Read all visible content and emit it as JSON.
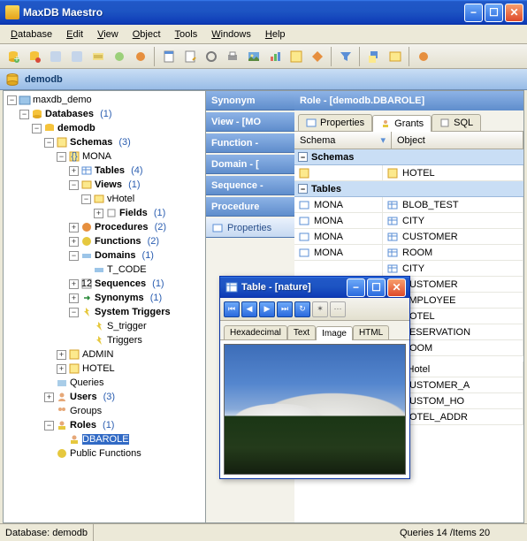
{
  "window": {
    "title": "MaxDB Maestro"
  },
  "menu": [
    "Database",
    "Edit",
    "View",
    "Object",
    "Tools",
    "Windows",
    "Help"
  ],
  "dbbar": {
    "name": "demodb"
  },
  "tree": {
    "root": "maxdb_demo",
    "databases": {
      "label": "Databases",
      "count": "(1)"
    },
    "demodb": "demodb",
    "schemas": {
      "label": "Schemas",
      "count": "(3)"
    },
    "mona": "MONA",
    "tables": {
      "label": "Tables",
      "count": "(4)"
    },
    "views": {
      "label": "Views",
      "count": "(1)"
    },
    "vhotel": "vHotel",
    "fields": {
      "label": "Fields",
      "count": "(1)"
    },
    "procedures": {
      "label": "Procedures",
      "count": "(2)"
    },
    "functions": {
      "label": "Functions",
      "count": "(2)"
    },
    "domains": {
      "label": "Domains",
      "count": "(1)"
    },
    "tcode": "T_CODE",
    "sequences": {
      "label": "Sequences",
      "count": "(1)"
    },
    "synonyms": {
      "label": "Synonyms",
      "count": "(1)"
    },
    "systriggers": "System Triggers",
    "strigger": "S_trigger",
    "triggers": "Triggers",
    "admin": "ADMIN",
    "hotel": "HOTEL",
    "queries": "Queries",
    "users": {
      "label": "Users",
      "count": "(3)"
    },
    "groups": "Groups",
    "roles": {
      "label": "Roles",
      "count": "(1)"
    },
    "dbarole": "DBAROLE",
    "pubfunc": "Public Functions"
  },
  "stacktabs": [
    "Synonym",
    "View - [MO",
    "Function -",
    "Domain - [",
    "Sequence -",
    "Procedure"
  ],
  "propTab": "Properties",
  "role": {
    "title": "Role - [demodb.DBAROLE]",
    "tabs": [
      "Properties",
      "Grants",
      "SQL"
    ],
    "col_schema": "Schema",
    "col_object": "Object",
    "sections": {
      "schemas": "Schemas",
      "tables": "Tables"
    },
    "rows": [
      {
        "schema": "",
        "object": "HOTEL"
      },
      {
        "schema": "MONA",
        "object": "BLOB_TEST"
      },
      {
        "schema": "MONA",
        "object": "CITY"
      },
      {
        "schema": "MONA",
        "object": "CUSTOMER"
      },
      {
        "schema": "MONA",
        "object": "ROOM"
      },
      {
        "schema": "",
        "object": "CITY"
      },
      {
        "schema": "",
        "object": "CUSTOMER"
      },
      {
        "schema": "",
        "object": "EMPLOYEE"
      },
      {
        "schema": "",
        "object": "HOTEL"
      },
      {
        "schema": "",
        "object": "RESERVATION"
      },
      {
        "schema": "",
        "object": "ROOM"
      }
    ],
    "views_rows": [
      {
        "object": "vHotel"
      },
      {
        "object": "CUSTOMER_A"
      },
      {
        "object": "CUSTOM_HO"
      },
      {
        "object": "HOTEL_ADDR"
      }
    ]
  },
  "child": {
    "title": "Table - [nature]",
    "tabs": [
      "Hexadecimal",
      "Text",
      "Image",
      "HTML"
    ]
  },
  "status": {
    "left": "Database: demodb",
    "right": "Queries 14 /Items 20"
  }
}
